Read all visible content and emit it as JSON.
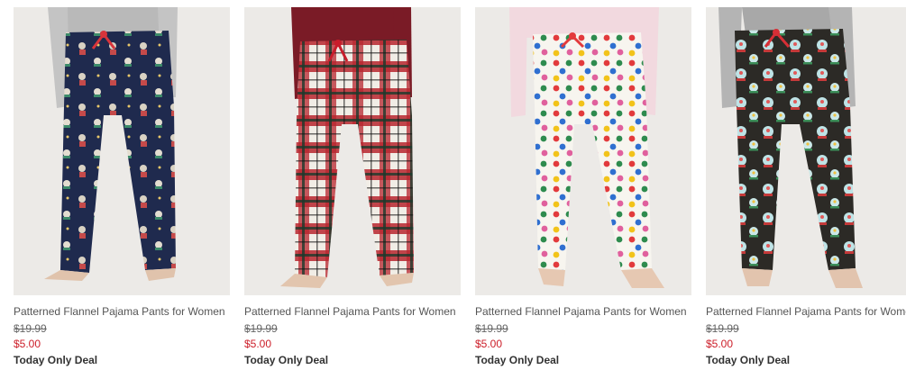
{
  "products": [
    {
      "name": "Patterned Flannel Pajama Pants for Women",
      "original_price": "$19.99",
      "sale_price": "$5.00",
      "promo": "Today Only Deal",
      "pattern": "navy-novelty-print",
      "colors": {
        "pants": "#1f2a4e",
        "top": "#b9b9b9",
        "tie": "#d8343b"
      }
    },
    {
      "name": "Patterned Flannel Pajama Pants for Women",
      "original_price": "$19.99",
      "sale_price": "$5.00",
      "promo": "Today Only Deal",
      "pattern": "red-plaid",
      "colors": {
        "pants": "#b8272f",
        "top": "#7a1b26",
        "tie": "#c81d2b"
      }
    },
    {
      "name": "Patterned Flannel Pajama Pants for Women",
      "original_price": "$19.99",
      "sale_price": "$5.00",
      "promo": "Today Only Deal",
      "pattern": "polka-dot",
      "colors": {
        "pants": "#f7f5ef",
        "top": "#f2d9df",
        "tie": "#e33a3c"
      }
    },
    {
      "name": "Patterned Flannel Pajama Pants for Women",
      "original_price": "$19.99",
      "sale_price": "$5.00",
      "promo": "Today Only Deal",
      "pattern": "snow-globe-print",
      "colors": {
        "pants": "#2c2a26",
        "top": "#a8a8a8",
        "tie": "#d62f36"
      }
    }
  ]
}
